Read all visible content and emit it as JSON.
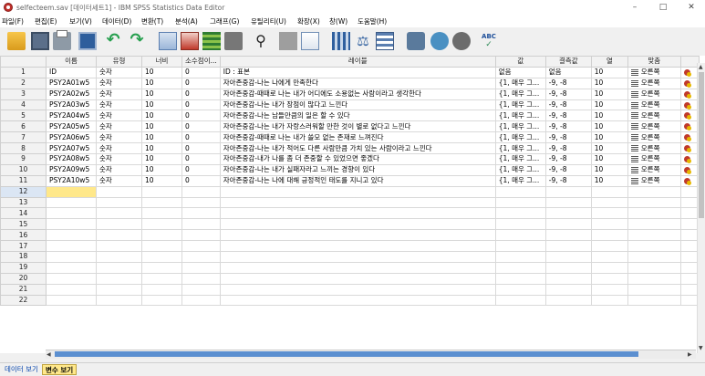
{
  "window": {
    "title": "selfecteem.sav [데이터세트1] - IBM SPSS Statistics Data Editor",
    "minimize": "–",
    "maximize": "□",
    "close": "✕"
  },
  "menu": [
    "파일(F)",
    "편집(E)",
    "보기(V)",
    "데이터(D)",
    "변환(T)",
    "분석(A)",
    "그래프(G)",
    "유틸리티(U)",
    "확장(X)",
    "창(W)",
    "도움말(H)"
  ],
  "toolbar_icons": [
    "open-icon",
    "save-icon",
    "print-icon",
    "dialog-recall-icon",
    "undo-icon",
    "redo-icon",
    "goto-case-icon",
    "goto-variable-icon",
    "variables-icon",
    "find-icon",
    "binoculars-icon",
    "insert-case-icon",
    "chart-icon",
    "split-file-icon",
    "weight-cases-icon",
    "select-cases-icon",
    "value-labels-icon",
    "use-sets-icon",
    "show-all-icon",
    "spell-check-icon"
  ],
  "columns": [
    "이름",
    "유형",
    "너비",
    "소수점이...",
    "레이블",
    "값",
    "결측값",
    "열",
    "맞춤"
  ],
  "rows": [
    {
      "num": "1",
      "name": "ID",
      "type": "숫자",
      "width": "10",
      "decimals": "0",
      "label": "ID : 표본",
      "values": "없음",
      "missing": "없음",
      "columns": "10",
      "align": "오른쪽"
    },
    {
      "num": "2",
      "name": "PSY2A01w5",
      "type": "숫자",
      "width": "10",
      "decimals": "0",
      "label": "자아존중감-나는 나에게 만족한다",
      "values": "{1, 매우 그...",
      "missing": "-9, -8",
      "columns": "10",
      "align": "오른쪽"
    },
    {
      "num": "3",
      "name": "PSY2A02w5",
      "type": "숫자",
      "width": "10",
      "decimals": "0",
      "label": "자아존중감-때때로 나는 내가 어디에도 소용없는 사람이라고 생각한다",
      "values": "{1, 매우 그...",
      "missing": "-9, -8",
      "columns": "10",
      "align": "오른쪽"
    },
    {
      "num": "4",
      "name": "PSY2A03w5",
      "type": "숫자",
      "width": "10",
      "decimals": "0",
      "label": "자아존중감-나는 내가 장점이 많다고 느낀다",
      "values": "{1, 매우 그...",
      "missing": "-9, -8",
      "columns": "10",
      "align": "오른쪽"
    },
    {
      "num": "5",
      "name": "PSY2A04w5",
      "type": "숫자",
      "width": "10",
      "decimals": "0",
      "label": "자아존중감-나는 남들만큼의 일은 할 수 있다",
      "values": "{1, 매우 그...",
      "missing": "-9, -8",
      "columns": "10",
      "align": "오른쪽"
    },
    {
      "num": "6",
      "name": "PSY2A05w5",
      "type": "숫자",
      "width": "10",
      "decimals": "0",
      "label": "자아존중감-나는 내가 자랑스러워할 만한 것이 별로 없다고 느낀다",
      "values": "{1, 매우 그...",
      "missing": "-9, -8",
      "columns": "10",
      "align": "오른쪽"
    },
    {
      "num": "7",
      "name": "PSY2A06w5",
      "type": "숫자",
      "width": "10",
      "decimals": "0",
      "label": "자아존중감-때때로 나는 내가 쓸모 없는 존재로 느껴진다",
      "values": "{1, 매우 그...",
      "missing": "-9, -8",
      "columns": "10",
      "align": "오른쪽"
    },
    {
      "num": "8",
      "name": "PSY2A07w5",
      "type": "숫자",
      "width": "10",
      "decimals": "0",
      "label": "자아존중감-나는 내가 적어도 다른 사람만큼 가치 있는 사람이라고 느낀다",
      "values": "{1, 매우 그...",
      "missing": "-9, -8",
      "columns": "10",
      "align": "오른쪽"
    },
    {
      "num": "9",
      "name": "PSY2A08w5",
      "type": "숫자",
      "width": "10",
      "decimals": "0",
      "label": "자아존중감-내가 나를 좀 더 존중할 수 있었으면 좋겠다",
      "values": "{1, 매우 그...",
      "missing": "-9, -8",
      "columns": "10",
      "align": "오른쪽"
    },
    {
      "num": "10",
      "name": "PSY2A09w5",
      "type": "숫자",
      "width": "10",
      "decimals": "0",
      "label": "자아존중감-나는 내가 실패자라고 느끼는 경향이 있다",
      "values": "{1, 매우 그...",
      "missing": "-9, -8",
      "columns": "10",
      "align": "오른쪽"
    },
    {
      "num": "11",
      "name": "PSY2A10w5",
      "type": "숫자",
      "width": "10",
      "decimals": "0",
      "label": "자아존중감-나는 나에 대해 긍정적인 태도를 지니고 있다",
      "values": "{1, 매우 그...",
      "missing": "-9, -8",
      "columns": "10",
      "align": "오른쪽"
    }
  ],
  "empty_rows": [
    "12",
    "13",
    "14",
    "15",
    "16",
    "17",
    "18",
    "19",
    "20",
    "21",
    "22"
  ],
  "tabs": {
    "data_view": "데이터 보기",
    "variable_view": "변수 보기"
  }
}
